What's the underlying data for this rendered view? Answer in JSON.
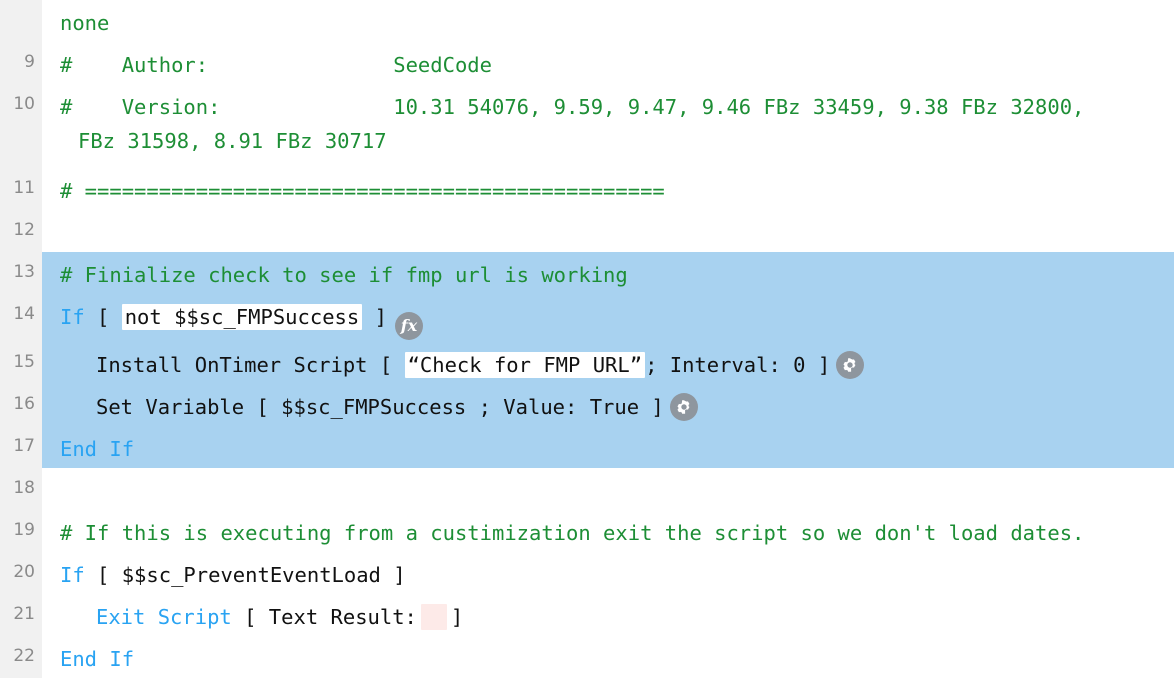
{
  "editor": {
    "name": "filemaker-script-workspace",
    "colors": {
      "comment_green": "#1d8e35",
      "keyword_blue": "#29a3f2",
      "selection_blue": "#a8d2f0",
      "gutter_gray": "#f1f1f1",
      "line_number_gray": "#8a8a8a",
      "icon_gray": "#8e969e",
      "pink_field": "#fdeae8",
      "background": "#ffffff"
    }
  },
  "lines": [
    {
      "number": "",
      "selected": false,
      "continuation": true,
      "text": "none",
      "style": "comment"
    },
    {
      "number": "9",
      "selected": false,
      "text": "#    Author:               SeedCode",
      "style": "comment"
    },
    {
      "number": "10",
      "selected": false,
      "text": "#    Version:              10.31 54076, 9.59, 9.47, 9.46 FBz 33459, 9.38 FBz 32800,",
      "style": "comment",
      "wrapped": "FBz 31598, 8.91 FBz 30717"
    },
    {
      "number": "11",
      "selected": false,
      "text": "# ===============================================",
      "style": "comment"
    },
    {
      "number": "12",
      "selected": false,
      "text": "",
      "style": "plain"
    },
    {
      "number": "13",
      "selected": true,
      "text": "# Finialize check to see if fmp url is working",
      "style": "comment"
    },
    {
      "number": "14",
      "selected": true,
      "style": "step-if",
      "keyword": "If",
      "open_bracket": "[",
      "calc": "not $$sc_FMPSuccess",
      "close_bracket": "]",
      "icon": "fx-icon",
      "icon_label": "fx"
    },
    {
      "number": "15",
      "selected": true,
      "style": "step-install-timer",
      "indent": 1,
      "step_name": "Install OnTimer Script",
      "open_bracket": "[",
      "script_name": "“Check for FMP URL”",
      "params": "; Interval: 0",
      "close_bracket": "]",
      "icon": "gear-icon"
    },
    {
      "number": "16",
      "selected": true,
      "style": "step-set-variable",
      "indent": 1,
      "step_name": "Set Variable",
      "open_bracket": "[",
      "params": "$$sc_FMPSuccess ; Value: True",
      "close_bracket": "]",
      "icon": "gear-icon"
    },
    {
      "number": "17",
      "selected": true,
      "style": "keyword",
      "text": "End If"
    },
    {
      "number": "18",
      "selected": false,
      "text": "",
      "style": "plain"
    },
    {
      "number": "19",
      "selected": false,
      "text": "# If this is executing from a custimization exit the script so we don't load dates.",
      "style": "comment"
    },
    {
      "number": "20",
      "selected": false,
      "style": "step-if-plain",
      "keyword": "If",
      "open_bracket": "[",
      "calc": "$$sc_PreventEventLoad",
      "close_bracket": "]"
    },
    {
      "number": "21",
      "selected": false,
      "style": "step-exit-script",
      "indent": 1,
      "keyword": "Exit Script",
      "open_bracket": "[",
      "label": "Text Result:",
      "empty_field": true,
      "close_bracket": "]"
    },
    {
      "number": "22",
      "selected": false,
      "style": "keyword",
      "text": "End If"
    }
  ]
}
